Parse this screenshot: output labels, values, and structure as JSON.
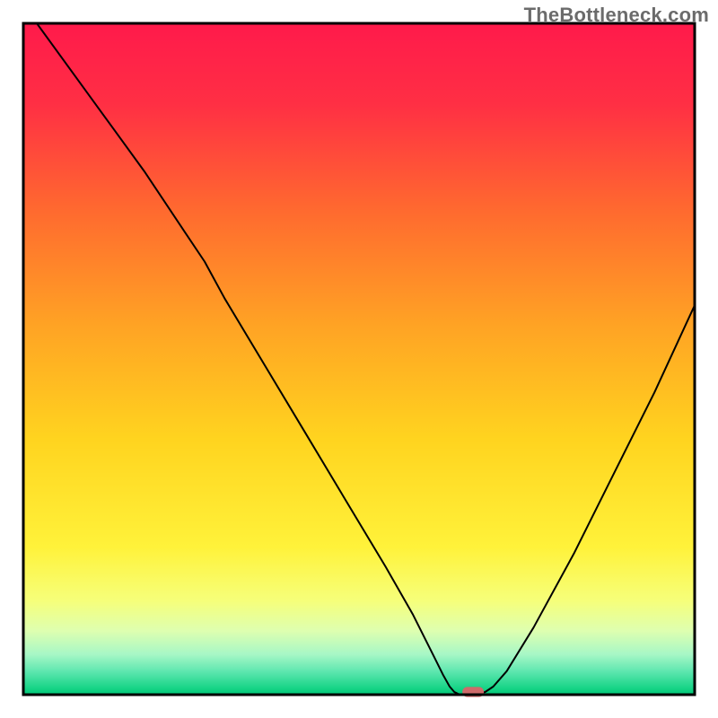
{
  "watermark": "TheBottleneck.com",
  "chart_data": {
    "type": "line",
    "title": "",
    "xlabel": "",
    "ylabel": "",
    "xlim": [
      0,
      100
    ],
    "ylim": [
      0,
      100
    ],
    "grid": false,
    "legend": false,
    "axes_visible": false,
    "background": {
      "type": "vertical-gradient-with-bands",
      "stops": [
        {
          "pos": 0.0,
          "color": "#ff1a4b"
        },
        {
          "pos": 0.12,
          "color": "#ff2f44"
        },
        {
          "pos": 0.28,
          "color": "#ff6a2f"
        },
        {
          "pos": 0.45,
          "color": "#ffa324"
        },
        {
          "pos": 0.62,
          "color": "#ffd41f"
        },
        {
          "pos": 0.78,
          "color": "#fff23a"
        },
        {
          "pos": 0.86,
          "color": "#f6ff7a"
        },
        {
          "pos": 0.905,
          "color": "#deffb0"
        },
        {
          "pos": 0.94,
          "color": "#a7f7c6"
        },
        {
          "pos": 0.965,
          "color": "#5fe7b0"
        },
        {
          "pos": 0.99,
          "color": "#18d487"
        },
        {
          "pos": 1.0,
          "color": "#00c978"
        }
      ]
    },
    "series": [
      {
        "name": "bottleneck-curve",
        "stroke": "#000000",
        "stroke_width": 2,
        "points_xy": [
          [
            2,
            100
          ],
          [
            10,
            89
          ],
          [
            18,
            78
          ],
          [
            24,
            69
          ],
          [
            27,
            64.5
          ],
          [
            30,
            59
          ],
          [
            36,
            49
          ],
          [
            42,
            39
          ],
          [
            48,
            29
          ],
          [
            54,
            19
          ],
          [
            58,
            12
          ],
          [
            61,
            6
          ],
          [
            62.5,
            3
          ],
          [
            63.5,
            1.2
          ],
          [
            64.2,
            0.4
          ],
          [
            65,
            0
          ],
          [
            67,
            0
          ],
          [
            68.8,
            0.4
          ],
          [
            70,
            1.2
          ],
          [
            72,
            3.5
          ],
          [
            76,
            10
          ],
          [
            82,
            21
          ],
          [
            88,
            33
          ],
          [
            94,
            45
          ],
          [
            100,
            58
          ]
        ]
      }
    ],
    "marker": {
      "name": "optimal-point",
      "shape": "rounded-rect",
      "x": 67,
      "y": 0,
      "width_pct": 3.2,
      "height_pct": 1.5,
      "fill": "#cf6a6a"
    },
    "frame": {
      "color": "#000000",
      "width": 3
    }
  }
}
